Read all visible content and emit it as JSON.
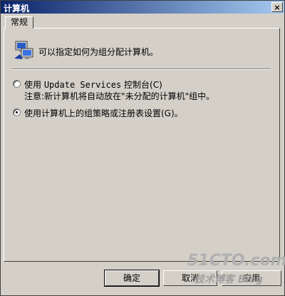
{
  "window": {
    "title": "计算机",
    "close_glyph": "×"
  },
  "tabs": [
    {
      "label": "常规"
    }
  ],
  "panel": {
    "intro": "可以指定如何为组分配计算机。",
    "options": [
      {
        "label_prefix": "使用 ",
        "label_mono": "Update Services",
        "label_suffix": " 控制台(C)",
        "checked": false
      },
      {
        "label": "使用计算机上的组策略或注册表设置(G)。",
        "checked": true
      }
    ],
    "note": "注意:新计算机将自动放在\"未分配的计算机\"组中。"
  },
  "buttons": {
    "ok": "确定",
    "cancel": "取消",
    "apply": "应用"
  },
  "watermark": {
    "line1": "51CTO.com",
    "line2": "技术博客 Blog"
  }
}
